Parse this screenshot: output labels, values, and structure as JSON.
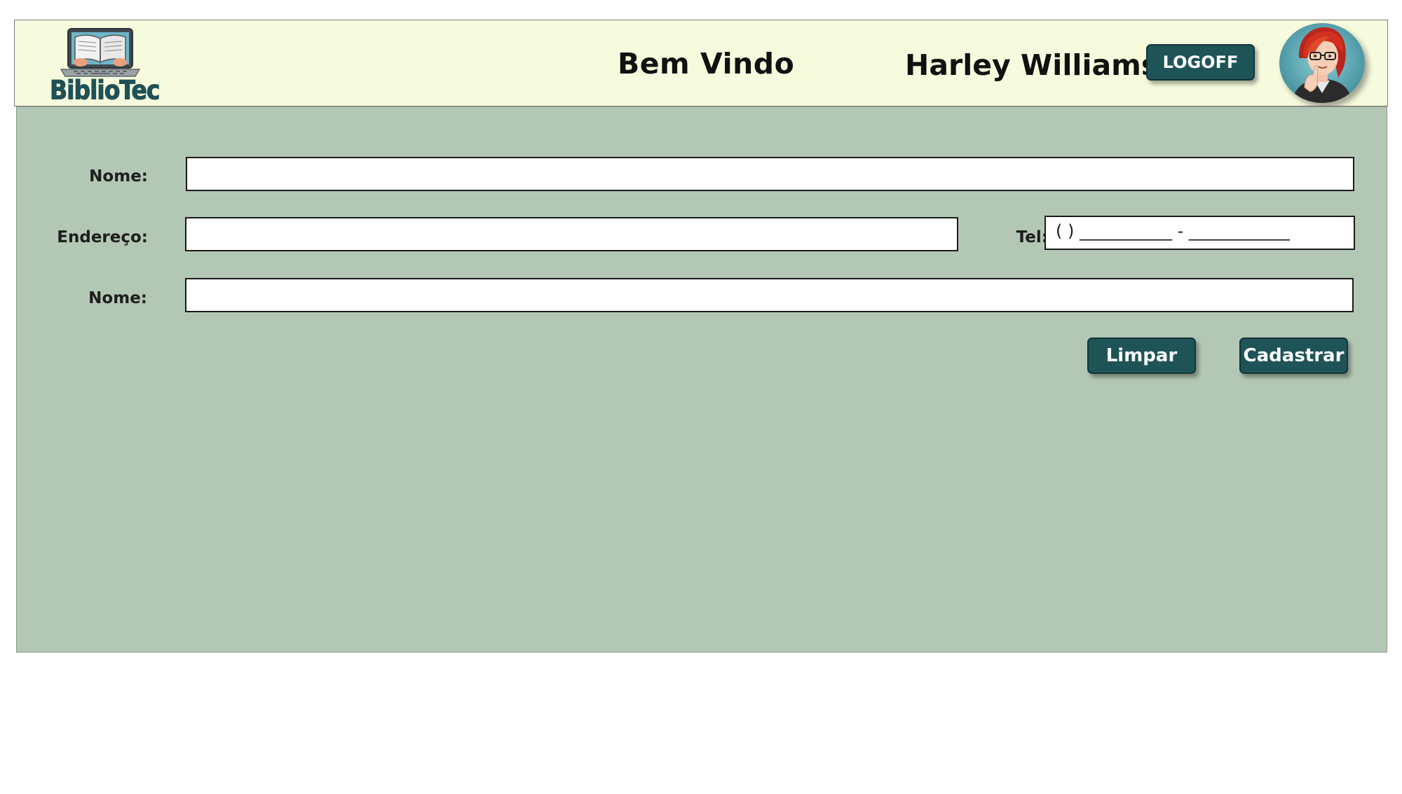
{
  "header": {
    "logo_text": "BiblioTec",
    "welcome": "Bem Vindo",
    "username": "Harley Williams",
    "logoff_label": "LOGOFF"
  },
  "form": {
    "nome_label": "Nome:",
    "endereco_label": "Endereço:",
    "tel_label": "Tel:",
    "tel_mask": "( ) ___________ - ____________",
    "nome2_label": "Nome:",
    "nome_value": "",
    "endereco_value": "",
    "nome2_value": ""
  },
  "actions": {
    "limpar_label": "Limpar",
    "cadastrar_label": "Cadastrar"
  },
  "colors": {
    "header_bg": "#f5fbdc",
    "main_bg": "#b3c8b4",
    "button_bg": "#1e5458",
    "logo_text": "#1f5156"
  },
  "icons": {
    "logo": "book-laptop-icon",
    "avatar": "user-avatar"
  }
}
